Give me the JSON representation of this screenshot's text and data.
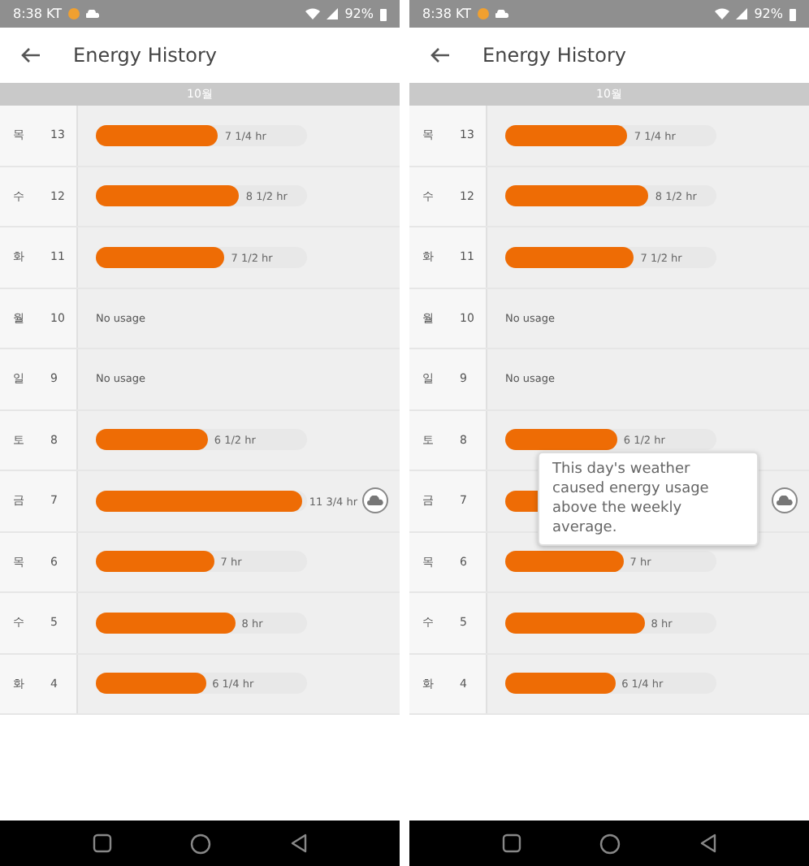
{
  "screens": [
    {
      "status_bar": {
        "time": "8:38 KT",
        "battery": "92%"
      },
      "title": "Energy History",
      "month": "10월",
      "rows": [
        {
          "day": "목",
          "date": "13",
          "kind": "bar",
          "level": 0.58,
          "reading": "7 1/4 hr",
          "weather": false
        },
        {
          "day": "수",
          "date": "12",
          "kind": "bar",
          "level": 0.68,
          "reading": "8 1/2 hr",
          "weather": false
        },
        {
          "day": "화",
          "date": "11",
          "kind": "bar",
          "level": 0.61,
          "reading": "7 1/2 hr",
          "weather": false
        },
        {
          "day": "월",
          "date": "10",
          "kind": "none",
          "reading": "No usage",
          "weather": false
        },
        {
          "day": "일",
          "date": "9",
          "kind": "none",
          "reading": "No usage",
          "weather": false
        },
        {
          "day": "토",
          "date": "8",
          "kind": "bar",
          "level": 0.53,
          "reading": "6 1/2 hr",
          "weather": false
        },
        {
          "day": "금",
          "date": "7",
          "kind": "bar",
          "level": 0.98,
          "reading": "11 3/4 hr",
          "weather": true
        },
        {
          "day": "목",
          "date": "6",
          "kind": "bar",
          "level": 0.56,
          "reading": "7 hr",
          "weather": false
        },
        {
          "day": "수",
          "date": "5",
          "kind": "bar",
          "level": 0.66,
          "reading": "8 hr",
          "weather": false
        },
        {
          "day": "화",
          "date": "4",
          "kind": "bar",
          "level": 0.52,
          "reading": "6 1/4 hr",
          "weather": false
        }
      ]
    },
    {
      "status_bar": {
        "time": "8:38 KT",
        "battery": "92%"
      },
      "title": "Energy History",
      "month": "10월",
      "rows": [
        {
          "day": "목",
          "date": "13",
          "kind": "bar",
          "level": 0.58,
          "reading": "7 1/4 hr",
          "weather": false
        },
        {
          "day": "수",
          "date": "12",
          "kind": "bar",
          "level": 0.68,
          "reading": "8 1/2 hr",
          "weather": false
        },
        {
          "day": "화",
          "date": "11",
          "kind": "bar",
          "level": 0.61,
          "reading": "7 1/2 hr",
          "weather": false
        },
        {
          "day": "월",
          "date": "10",
          "kind": "none",
          "reading": "No usage",
          "weather": false
        },
        {
          "day": "일",
          "date": "9",
          "kind": "none",
          "reading": "No usage",
          "weather": false
        },
        {
          "day": "토",
          "date": "8",
          "kind": "bar",
          "level": 0.53,
          "reading": "6 1/2 hr",
          "weather": false
        },
        {
          "day": "금",
          "date": "7",
          "kind": "bar",
          "level": 0.98,
          "weather": true,
          "tooltip": "This day's weather caused energy usage above the weekly average."
        },
        {
          "day": "목",
          "date": "6",
          "kind": "bar",
          "level": 0.56,
          "reading": "7 hr",
          "weather": false
        },
        {
          "day": "수",
          "date": "5",
          "kind": "bar",
          "level": 0.66,
          "reading": "8 hr",
          "weather": false
        },
        {
          "day": "화",
          "date": "4",
          "kind": "bar",
          "level": 0.52,
          "reading": "6 1/4 hr",
          "weather": false
        }
      ]
    }
  ]
}
